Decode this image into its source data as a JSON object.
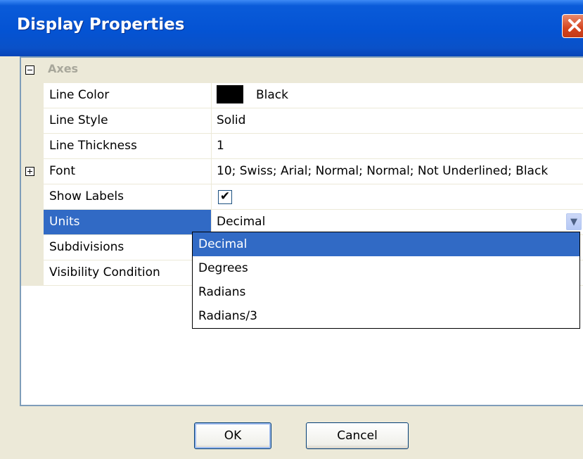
{
  "window": {
    "title": "Display Properties"
  },
  "category": {
    "label": "Axes"
  },
  "properties": [
    {
      "name": "Line Color",
      "value": "Black"
    },
    {
      "name": "Line Style",
      "value": "Solid"
    },
    {
      "name": "Line Thickness",
      "value": "1"
    },
    {
      "name": "Font",
      "value": "10; Swiss; Arial; Normal; Normal; Not Underlined; Black"
    },
    {
      "name": "Show Labels",
      "value": ""
    },
    {
      "name": "Units",
      "value": "Decimal"
    },
    {
      "name": "Subdivisions",
      "value": ""
    },
    {
      "name": "Visibility Condition",
      "value": ""
    }
  ],
  "line_color_swatch": "#000000",
  "show_labels_checked": true,
  "units_dropdown": {
    "options": [
      "Decimal",
      "Degrees",
      "Radians",
      "Radians/3"
    ],
    "selected": "Decimal"
  },
  "buttons": {
    "ok": "OK",
    "cancel": "Cancel"
  },
  "icons": {
    "close": "close-icon",
    "collapse": "minus-box-icon",
    "expand": "plus-box-icon",
    "dropdown": "chevron-down-icon"
  },
  "colors": {
    "selection": "#316ac5",
    "titlebar": "#0453d3"
  }
}
